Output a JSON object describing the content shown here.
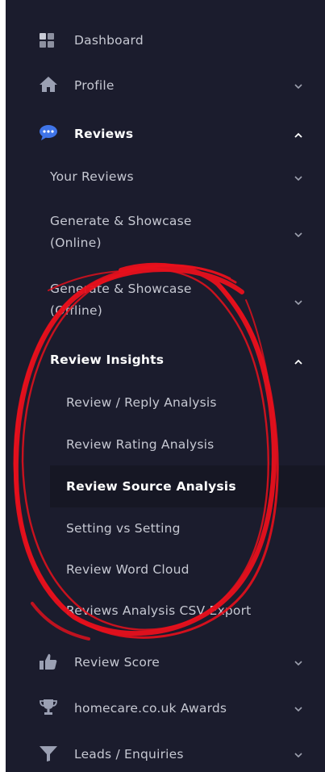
{
  "menu": {
    "dashboard": "Dashboard",
    "profile": "Profile",
    "reviews": "Reviews",
    "your_reviews": "Your Reviews",
    "generate_online": [
      "Generate & Showcase",
      "(Online)"
    ],
    "generate_offline": [
      "Generate & Showcase",
      "(Offline)"
    ],
    "review_insights": "Review Insights",
    "insights_items": [
      "Review / Reply Analysis",
      "Review Rating Analysis",
      "Review Source Analysis",
      "Setting vs Setting",
      "Review Word Cloud",
      "Reviews Analysis CSV Export"
    ],
    "review_score": "Review Score",
    "awards": "homecare.co.uk Awards",
    "leads": "Leads / Enquiries"
  },
  "colors": {
    "sidebar_bg": "#1b1c2d",
    "text": "#c6c8d2",
    "active_text": "#ffffff",
    "accent_blue": "#3f74e8",
    "annotation_red": "#e8101c"
  },
  "icons": {
    "dashboard": "grid-icon",
    "profile": "home-icon",
    "reviews": "chat-bubble-icon",
    "review_score": "thumbs-up-icon",
    "awards": "trophy-icon",
    "leads": "funnel-icon"
  }
}
